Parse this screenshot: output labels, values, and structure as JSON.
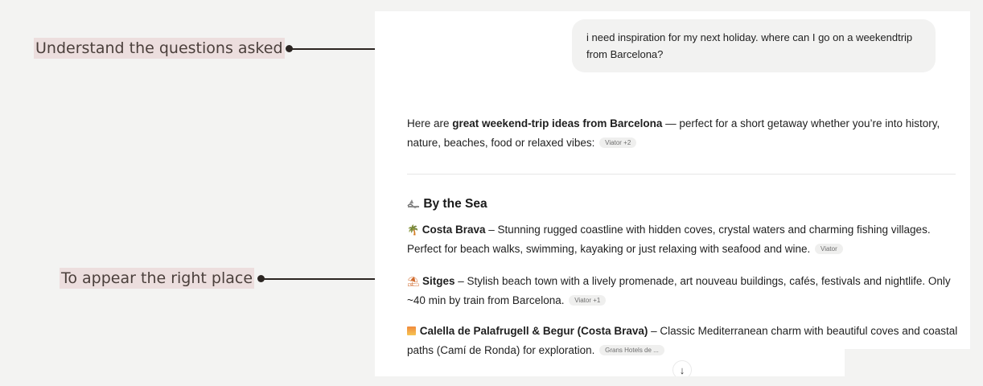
{
  "annotations": [
    {
      "label": "Understand the questions asked"
    },
    {
      "label": "To appear the right place"
    }
  ],
  "chat": {
    "user_message": "i need inspiration for my next holiday. where can I go on a weekendtrip from Barcelona?",
    "intro": {
      "before": "Here are ",
      "bold": "great weekend-trip ideas from Barcelona",
      "after": " — perfect for a short getaway whether you’re into history, nature, beaches, food or relaxed vibes:",
      "source": "Viator +2"
    },
    "section_heading": "By the Sea",
    "section_icon": "beach-wave-icon",
    "items": [
      {
        "icon": "palm-tree-icon",
        "glyph": "🌴",
        "title": "Costa Brava",
        "text": " – Stunning rugged coastline with hidden coves, crystal waters and charming fishing villages. Perfect for beach walks, swimming, kayaking or just relaxing with seafood and wine.",
        "source": "Viator"
      },
      {
        "icon": "beach-umbrella-icon",
        "glyph": "⛱",
        "title": "Sitges",
        "text": " – Stylish beach town with a lively promenade, art nouveau buildings, cafés, festivals and nightlife. Only ~40 min by train from Barcelona.",
        "source": "Viator +1"
      },
      {
        "icon": "sunrise-icon",
        "glyph": "",
        "title": "Calella de Palafrugell & Begur (Costa Brava)",
        "text": " – Classic Mediterranean charm with beautiful coves and coastal paths (Camí de Ronda) for exploration.",
        "source": "Grans Hotels de ..."
      }
    ],
    "scroll_glyph": "↓"
  },
  "colors": {
    "annotation_bg": "#ecdede",
    "bubble_bg": "#f2f2f1",
    "page_bg": "#f3f3f2"
  }
}
